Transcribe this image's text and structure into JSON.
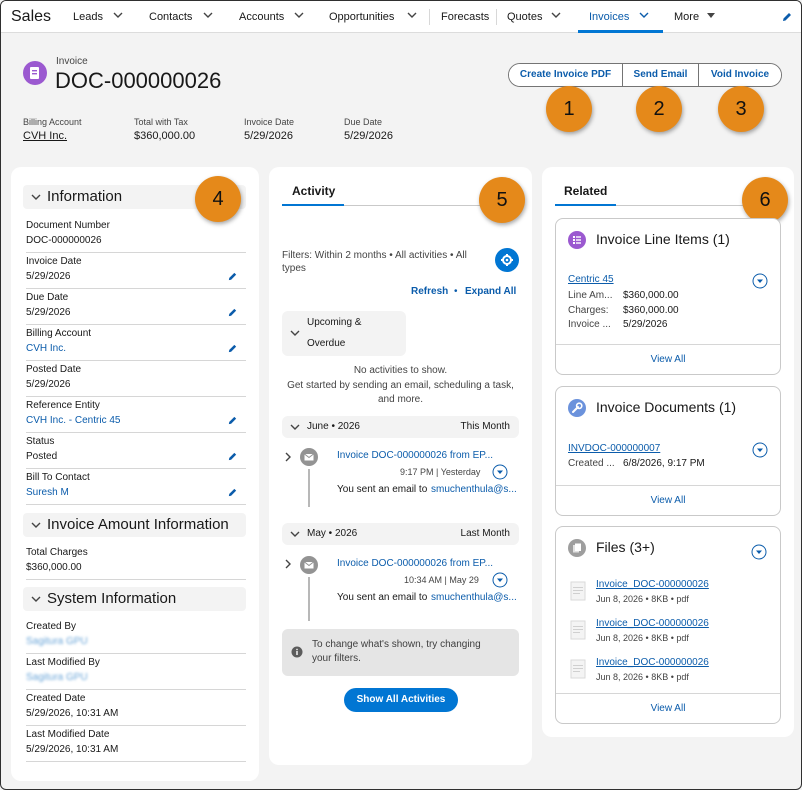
{
  "nav": {
    "app_name": "Sales",
    "items": [
      "Leads",
      "Contacts",
      "Accounts",
      "Opportunities",
      "Forecasts",
      "Quotes",
      "Invoices",
      "More"
    ],
    "active": "Invoices"
  },
  "header": {
    "object_type": "Invoice",
    "title": "DOC-000000026",
    "buttons": [
      "Create Invoice PDF",
      "Send Email",
      "Void Invoice"
    ],
    "fields": [
      {
        "label": "Billing Account",
        "value": "CVH Inc."
      },
      {
        "label": "Total with Tax",
        "value": "$360,000.00"
      },
      {
        "label": "Invoice Date",
        "value": "5/29/2026"
      },
      {
        "label": "Due Date",
        "value": "5/29/2026"
      }
    ]
  },
  "callouts": [
    "1",
    "2",
    "3",
    "4",
    "5",
    "6"
  ],
  "details": {
    "information_title": "Information",
    "fields": [
      {
        "label": "Document Number",
        "value": "DOC-000000026"
      },
      {
        "label": "Invoice Date",
        "value": "5/29/2026"
      },
      {
        "label": "Due Date",
        "value": "5/29/2026"
      },
      {
        "label": "Billing Account",
        "value": "CVH Inc."
      },
      {
        "label": "Posted Date",
        "value": "5/29/2026"
      },
      {
        "label": "Reference Entity",
        "value": "CVH Inc. - Centric 45"
      },
      {
        "label": "Status",
        "value": "Posted"
      },
      {
        "label": "Bill To Contact",
        "value": "Suresh M"
      }
    ],
    "amount_title": "Invoice Amount Information",
    "amount_fields": [
      {
        "label": "Total Charges",
        "value": "$360,000.00"
      }
    ],
    "system_title": "System Information",
    "system_fields": [
      {
        "label": "Created By",
        "value": "Sagitura GPU"
      },
      {
        "label": "Last Modified By",
        "value": "Sagitura GPU"
      },
      {
        "label": "Created Date",
        "value": "5/29/2026, 10:31 AM"
      },
      {
        "label": "Last Modified Date",
        "value": "5/29/2026, 10:31 AM"
      }
    ]
  },
  "activity": {
    "tab": "Activity",
    "filters_line1": "Filters: Within 2 months • All activities • All",
    "filters_line2": "types",
    "refresh": "Refresh",
    "dot": "•",
    "expand_all": "Expand All",
    "upcoming_line1": "Upcoming &",
    "upcoming_line2": "Overdue",
    "no_activities": "No activities to show.",
    "get_started_line1": "Get started by sending an email, scheduling a task,",
    "get_started_line2": "and more.",
    "groups": [
      {
        "month": "June • 2026",
        "relative": "This Month",
        "subject": "Invoice DOC-000000026 from EP...",
        "time": "9:17 PM | Yesterday",
        "desc_prefix": "You sent an email to",
        "recipient": "smuchenthula@s..."
      },
      {
        "month": "May • 2026",
        "relative": "Last Month",
        "subject": "Invoice DOC-000000026 from EP...",
        "time": "10:34 AM | May 29",
        "desc_prefix": "You sent an email to",
        "recipient": "smuchenthula@s..."
      }
    ],
    "info_line1": "To change what's shown, try changing",
    "info_line2": "your filters.",
    "show_all": "Show All Activities"
  },
  "related": {
    "tab": "Related",
    "line_items": {
      "title": "Invoice Line Items (1)",
      "record": "Centric 45",
      "rows": [
        {
          "label": "Line Am...",
          "value": "$360,000.00"
        },
        {
          "label": "Charges:",
          "value": "$360,000.00"
        },
        {
          "label": "Invoice ...",
          "value": "5/29/2026"
        }
      ],
      "view_all": "View All"
    },
    "documents": {
      "title": "Invoice Documents (1)",
      "record": "INVDOC-000000007",
      "row_label": "Created ...",
      "row_value": "6/8/2026, 9:17 PM",
      "view_all": "View All"
    },
    "files": {
      "title": "Files (3+)",
      "items": [
        {
          "name": "Invoice_DOC-000000026",
          "meta": "Jun 8, 2026 • 8KB • pdf"
        },
        {
          "name": "Invoice_DOC-000000026",
          "meta": "Jun 8, 2026 • 8KB • pdf"
        },
        {
          "name": "Invoice_DOC-000000026",
          "meta": "Jun 8, 2026 • 8KB • pdf"
        }
      ],
      "view_all": "View All"
    }
  },
  "colors": {
    "brand": "#0176d3",
    "callout": "#e5891a",
    "link": "#0b5cab"
  }
}
